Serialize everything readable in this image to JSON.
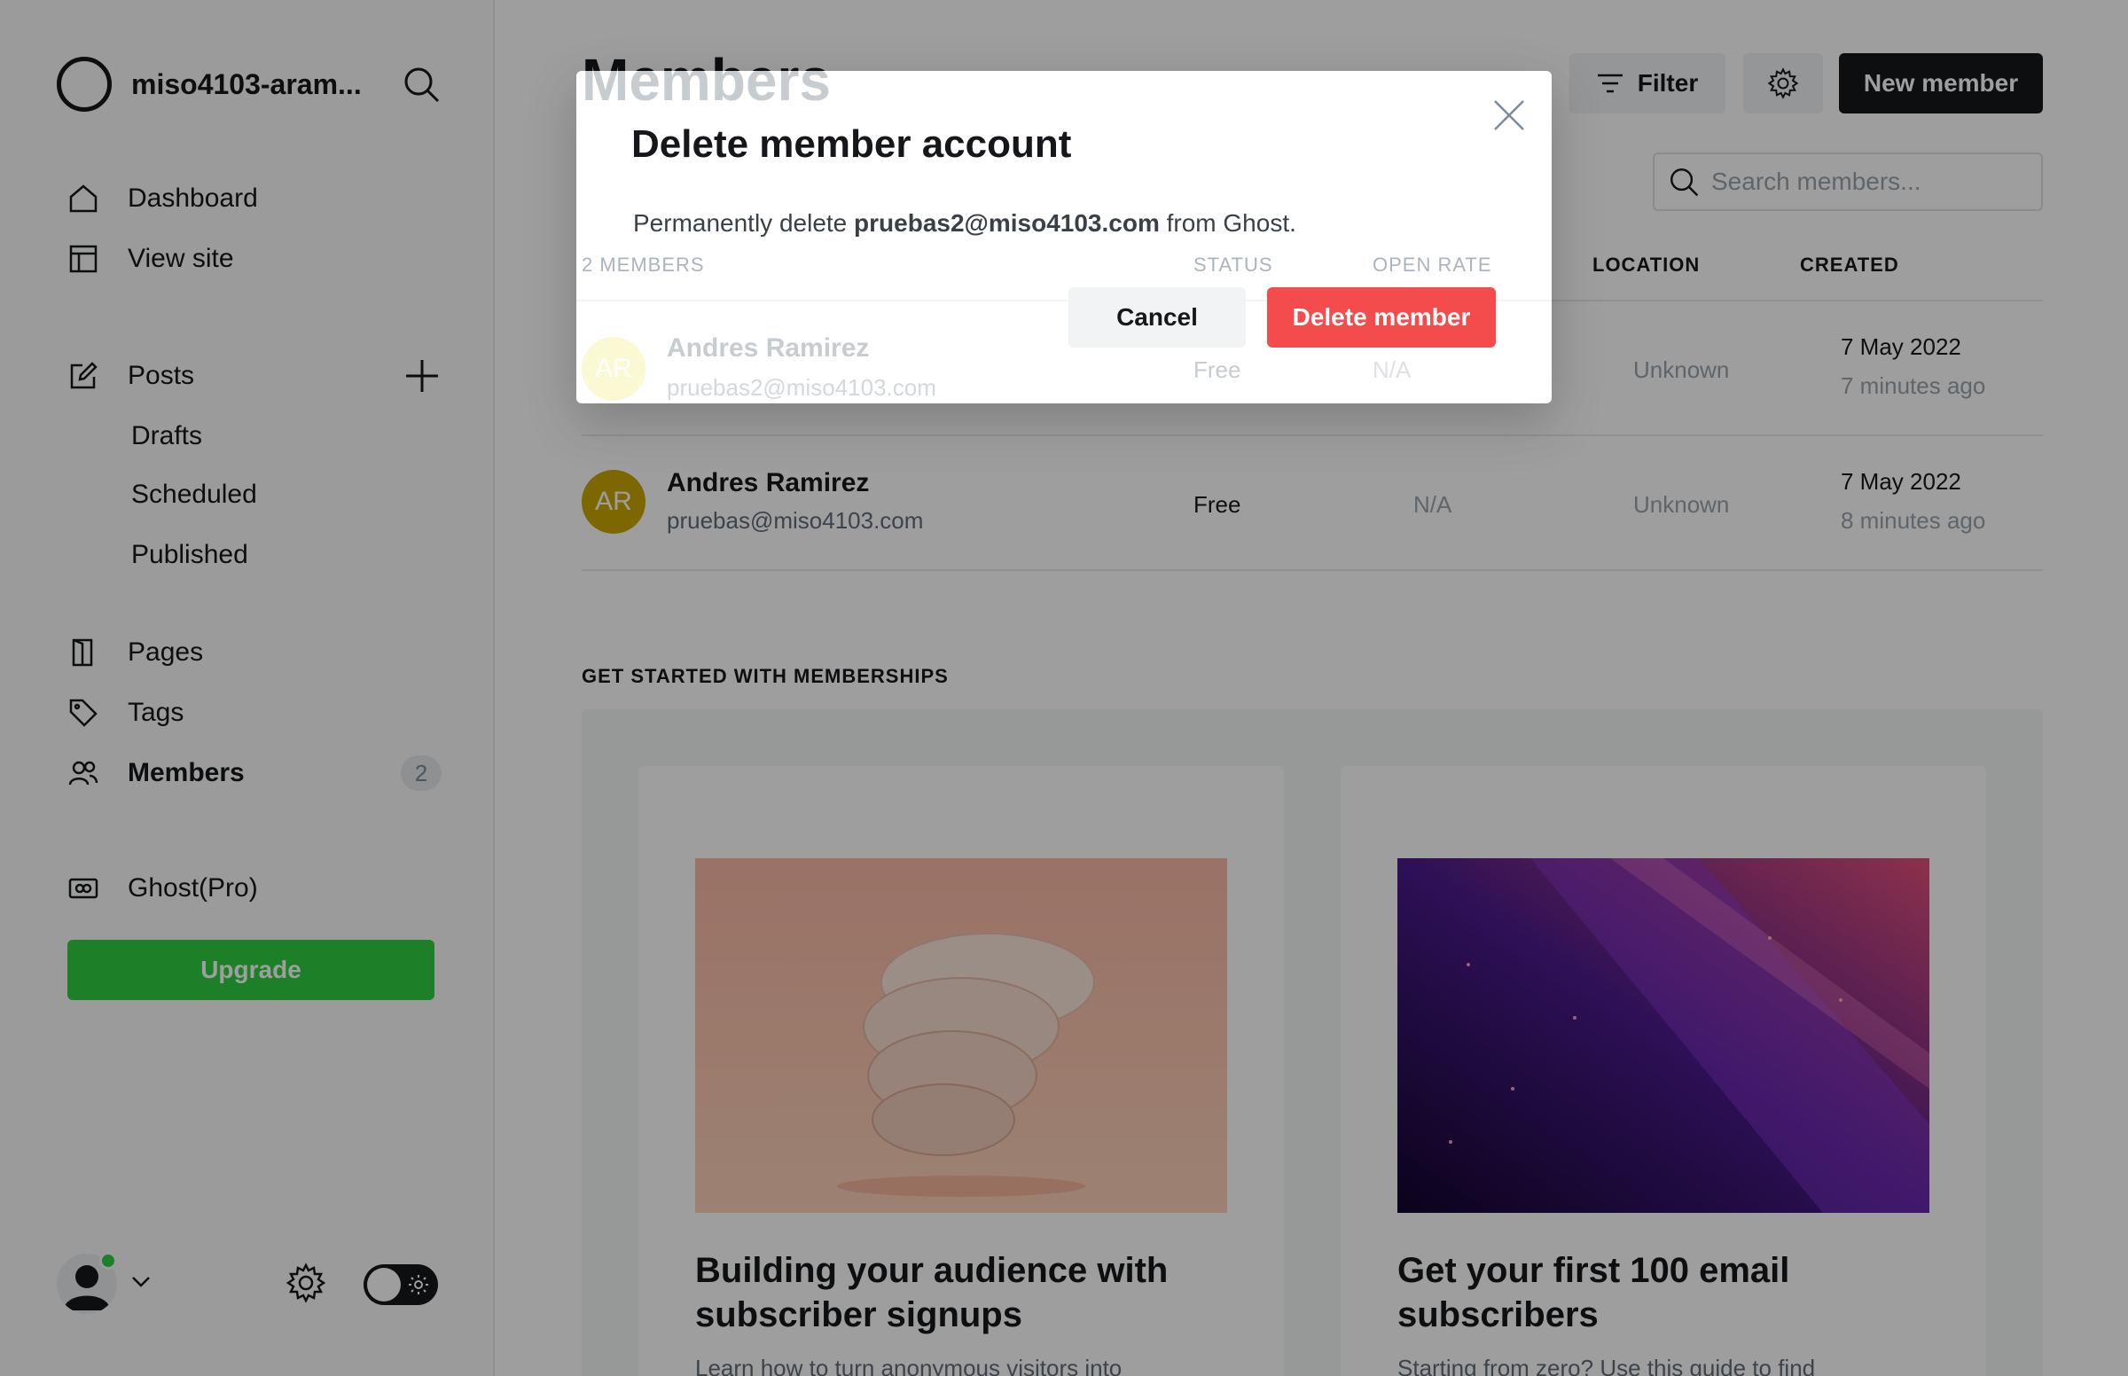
{
  "sidebar": {
    "site_name": "miso4103-aram...",
    "nav": {
      "dashboard": "Dashboard",
      "view_site": "View site",
      "posts": "Posts",
      "drafts": "Drafts",
      "scheduled": "Scheduled",
      "published": "Published",
      "pages": "Pages",
      "tags": "Tags",
      "members": "Members",
      "members_count": "2",
      "ghost_pro": "Ghost(Pro)"
    },
    "upgrade_label": "Upgrade"
  },
  "header": {
    "title": "Members",
    "filter_label": "Filter",
    "new_member_label": "New member",
    "search_placeholder": "Search members..."
  },
  "table": {
    "headers": {
      "members": "2 MEMBERS",
      "status": "STATUS",
      "open_rate": "OPEN RATE",
      "location": "LOCATION",
      "created": "CREATED"
    },
    "rows": [
      {
        "initials": "AR",
        "name": "Andres Ramirez",
        "email": "pruebas2@miso4103.com",
        "status": "Free",
        "open_rate": "N/A",
        "location": "Unknown",
        "date": "7 May 2022",
        "ago": "7 minutes ago",
        "color": "#f6e36b"
      },
      {
        "initials": "AR",
        "name": "Andres Ramirez",
        "email": "pruebas@miso4103.com",
        "status": "Free",
        "open_rate": "N/A",
        "location": "Unknown",
        "date": "7 May 2022",
        "ago": "8 minutes ago",
        "color": "#c9a700"
      }
    ]
  },
  "get_started": {
    "title": "GET STARTED WITH MEMBERSHIPS",
    "cards": [
      {
        "title": "Building your audience with subscriber signups",
        "text": "Learn how to turn anonymous visitors into"
      },
      {
        "title": "Get your first 100 email subscribers",
        "text": "Starting from zero? Use this guide to find"
      }
    ]
  },
  "modal": {
    "title": "Delete member account",
    "body_prefix": "Permanently delete ",
    "body_email": "pruebas2@miso4103.com",
    "body_suffix": " from Ghost.",
    "cancel_label": "Cancel",
    "delete_label": "Delete member"
  },
  "colors": {
    "accent_green": "#30cf43",
    "danger_red": "#f44c4c",
    "dark": "#15171a"
  }
}
